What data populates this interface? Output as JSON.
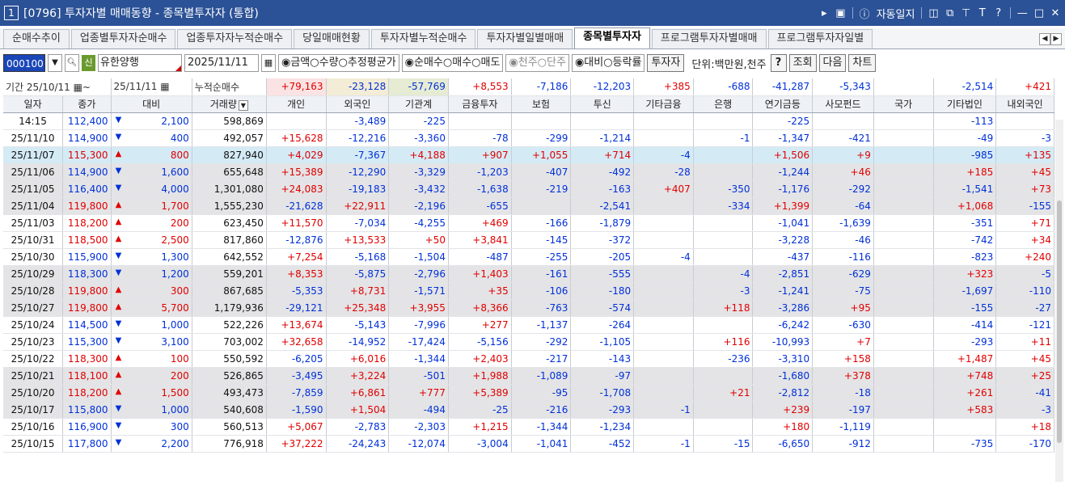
{
  "window": {
    "number": "1",
    "title": "[0796] 투자자별 매매동향 - 종목별투자자 (통합)",
    "autolog": "자동일지"
  },
  "tabs": [
    "순매수추이",
    "업종별투자자순매수",
    "업종투자자누적순매수",
    "당일매매현황",
    "투자자별누적순매수",
    "투자자별일별매매",
    "종목별투자자",
    "프로그램투자자별매매",
    "프로그램투자자일별"
  ],
  "controls": {
    "code": "000100",
    "sin": "신",
    "stock_name": "유한양행",
    "date": "2025/11/11",
    "radio_value": "◉금액○수량○추정평균가",
    "radio_trade": "◉순매수○매수○매도",
    "radio_unit": "◉천주○단주",
    "radio_compare": "◉대비○등락률",
    "investor_btn": "투자자",
    "unit_text": "단위:백만원,천주",
    "help_btn": "?",
    "query_btn": "조회",
    "next_btn": "다음",
    "chart_btn": "차트"
  },
  "period": {
    "label": "기간",
    "from": "25/10/11",
    "to": "25/11/11",
    "sum_label": "누적순매수",
    "sums": [
      "+79,163",
      "-23,128",
      "-57,769",
      "+8,553",
      "-7,186",
      "-12,203",
      "+385",
      "-688",
      "-41,287",
      "-5,343",
      "",
      "-2,514",
      "+421"
    ]
  },
  "columns": [
    "일자",
    "종가",
    "대비",
    "거래량",
    "개인",
    "외국인",
    "기관계",
    "금융투자",
    "보험",
    "투신",
    "기타금융",
    "은행",
    "연기금등",
    "사모펀드",
    "국가",
    "기타법인",
    "내외국인"
  ],
  "rows": [
    {
      "date": "14:15",
      "close": "112,400",
      "dir": "down",
      "change": "2,100",
      "volume": "598,869",
      "cells": [
        "",
        "-3,489",
        "-225",
        "",
        "",
        "",
        "",
        "",
        "-225",
        "",
        "",
        "-113",
        ""
      ]
    },
    {
      "date": "25/11/10",
      "close": "114,900",
      "dir": "down",
      "change": "400",
      "volume": "492,057",
      "cells": [
        "+15,628",
        "-12,216",
        "-3,360",
        "-78",
        "-299",
        "-1,214",
        "",
        "-1",
        "-1,347",
        "-421",
        "",
        "-49",
        "-3"
      ]
    },
    {
      "date": "25/11/07",
      "close": "115,300",
      "dir": "up",
      "change": "800",
      "volume": "827,940",
      "cells": [
        "+4,029",
        "-7,367",
        "+4,188",
        "+907",
        "+1,055",
        "+714",
        "-4",
        "",
        "+1,506",
        "+9",
        "",
        "-985",
        "+135"
      ]
    },
    {
      "date": "25/11/06",
      "close": "114,900",
      "dir": "down",
      "change": "1,600",
      "volume": "655,648",
      "cells": [
        "+15,389",
        "-12,290",
        "-3,329",
        "-1,203",
        "-407",
        "-492",
        "-28",
        "",
        "-1,244",
        "+46",
        "",
        "+185",
        "+45"
      ]
    },
    {
      "date": "25/11/05",
      "close": "116,400",
      "dir": "down",
      "change": "4,000",
      "volume": "1,301,080",
      "cells": [
        "+24,083",
        "-19,183",
        "-3,432",
        "-1,638",
        "-219",
        "-163",
        "+407",
        "-350",
        "-1,176",
        "-292",
        "",
        "-1,541",
        "+73"
      ]
    },
    {
      "date": "25/11/04",
      "close": "119,800",
      "dir": "up",
      "change": "1,700",
      "volume": "1,555,230",
      "cells": [
        "-21,628",
        "+22,911",
        "-2,196",
        "-655",
        "",
        "-2,541",
        "",
        "-334",
        "+1,399",
        "-64",
        "",
        "+1,068",
        "-155"
      ]
    },
    {
      "date": "25/11/03",
      "close": "118,200",
      "dir": "up",
      "change": "200",
      "volume": "623,450",
      "cells": [
        "+11,570",
        "-7,034",
        "-4,255",
        "+469",
        "-166",
        "-1,879",
        "",
        "",
        "-1,041",
        "-1,639",
        "",
        "-351",
        "+71"
      ]
    },
    {
      "date": "25/10/31",
      "close": "118,500",
      "dir": "up",
      "change": "2,500",
      "volume": "817,860",
      "cells": [
        "-12,876",
        "+13,533",
        "+50",
        "+3,841",
        "-145",
        "-372",
        "",
        "",
        "-3,228",
        "-46",
        "",
        "-742",
        "+34"
      ]
    },
    {
      "date": "25/10/30",
      "close": "115,900",
      "dir": "down",
      "change": "1,300",
      "volume": "642,552",
      "cells": [
        "+7,254",
        "-5,168",
        "-1,504",
        "-487",
        "-255",
        "-205",
        "-4",
        "",
        "-437",
        "-116",
        "",
        "-823",
        "+240"
      ]
    },
    {
      "date": "25/10/29",
      "close": "118,300",
      "dir": "down",
      "change": "1,200",
      "volume": "559,201",
      "cells": [
        "+8,353",
        "-5,875",
        "-2,796",
        "+1,403",
        "-161",
        "-555",
        "",
        "-4",
        "-2,851",
        "-629",
        "",
        "+323",
        "-5"
      ]
    },
    {
      "date": "25/10/28",
      "close": "119,800",
      "dir": "up",
      "change": "300",
      "volume": "867,685",
      "cells": [
        "-5,353",
        "+8,731",
        "-1,571",
        "+35",
        "-106",
        "-180",
        "",
        "-3",
        "-1,241",
        "-75",
        "",
        "-1,697",
        "-110"
      ]
    },
    {
      "date": "25/10/27",
      "close": "119,800",
      "dir": "up",
      "change": "5,700",
      "volume": "1,179,936",
      "cells": [
        "-29,121",
        "+25,348",
        "+3,955",
        "+8,366",
        "-763",
        "-574",
        "",
        "+118",
        "-3,286",
        "+95",
        "",
        "-155",
        "-27"
      ]
    },
    {
      "date": "25/10/24",
      "close": "114,500",
      "dir": "down",
      "change": "1,000",
      "volume": "522,226",
      "cells": [
        "+13,674",
        "-5,143",
        "-7,996",
        "+277",
        "-1,137",
        "-264",
        "",
        "",
        "-6,242",
        "-630",
        "",
        "-414",
        "-121"
      ]
    },
    {
      "date": "25/10/23",
      "close": "115,300",
      "dir": "down",
      "change": "3,100",
      "volume": "703,002",
      "cells": [
        "+32,658",
        "-14,952",
        "-17,424",
        "-5,156",
        "-292",
        "-1,105",
        "",
        "+116",
        "-10,993",
        "+7",
        "",
        "-293",
        "+11"
      ]
    },
    {
      "date": "25/10/22",
      "close": "118,300",
      "dir": "up",
      "change": "100",
      "volume": "550,592",
      "cells": [
        "-6,205",
        "+6,016",
        "-1,344",
        "+2,403",
        "-217",
        "-143",
        "",
        "-236",
        "-3,310",
        "+158",
        "",
        "+1,487",
        "+45"
      ]
    },
    {
      "date": "25/10/21",
      "close": "118,100",
      "dir": "up",
      "change": "200",
      "volume": "526,865",
      "cells": [
        "-3,495",
        "+3,224",
        "-501",
        "+1,988",
        "-1,089",
        "-97",
        "",
        "",
        "-1,680",
        "+378",
        "",
        "+748",
        "+25"
      ]
    },
    {
      "date": "25/10/20",
      "close": "118,200",
      "dir": "up",
      "change": "1,500",
      "volume": "493,473",
      "cells": [
        "-7,859",
        "+6,861",
        "+777",
        "+5,389",
        "-95",
        "-1,708",
        "",
        "+21",
        "-2,812",
        "-18",
        "",
        "+261",
        "-41"
      ]
    },
    {
      "date": "25/10/17",
      "close": "115,800",
      "dir": "down",
      "change": "1,000",
      "volume": "540,608",
      "cells": [
        "-1,590",
        "+1,504",
        "-494",
        "-25",
        "-216",
        "-293",
        "-1",
        "",
        "+239",
        "-197",
        "",
        "+583",
        "-3"
      ]
    },
    {
      "date": "25/10/16",
      "close": "116,900",
      "dir": "down",
      "change": "300",
      "volume": "560,513",
      "cells": [
        "+5,067",
        "-2,783",
        "-2,303",
        "+1,215",
        "-1,344",
        "-1,234",
        "",
        "",
        "+180",
        "-1,119",
        "",
        "",
        "+18"
      ]
    },
    {
      "date": "25/10/15",
      "close": "117,800",
      "dir": "down",
      "change": "2,200",
      "volume": "776,918",
      "cells": [
        "+37,222",
        "-24,243",
        "-12,074",
        "-3,004",
        "-1,041",
        "-452",
        "-1",
        "-15",
        "-6,650",
        "-912",
        "",
        "-735",
        "-170"
      ]
    }
  ],
  "row_shading": [
    "white",
    "white",
    "selected",
    "gray",
    "gray",
    "gray",
    "white",
    "white",
    "white",
    "gray",
    "gray",
    "gray",
    "white",
    "white",
    "white",
    "gray",
    "gray",
    "gray",
    "white",
    "white"
  ],
  "colors": {
    "titlebar": "#2b5196",
    "up": "#e00000",
    "down": "#0030d8",
    "code_bg": "#1a46b8",
    "selected_row": "#d4ebf6",
    "alt_row": "#e4e4e6"
  },
  "icons": {
    "calendar": "calendar-icon",
    "search": "search-icon",
    "dropdown": "chevron-down-icon",
    "up_arrow": "▲",
    "down_arrow": "▼"
  }
}
